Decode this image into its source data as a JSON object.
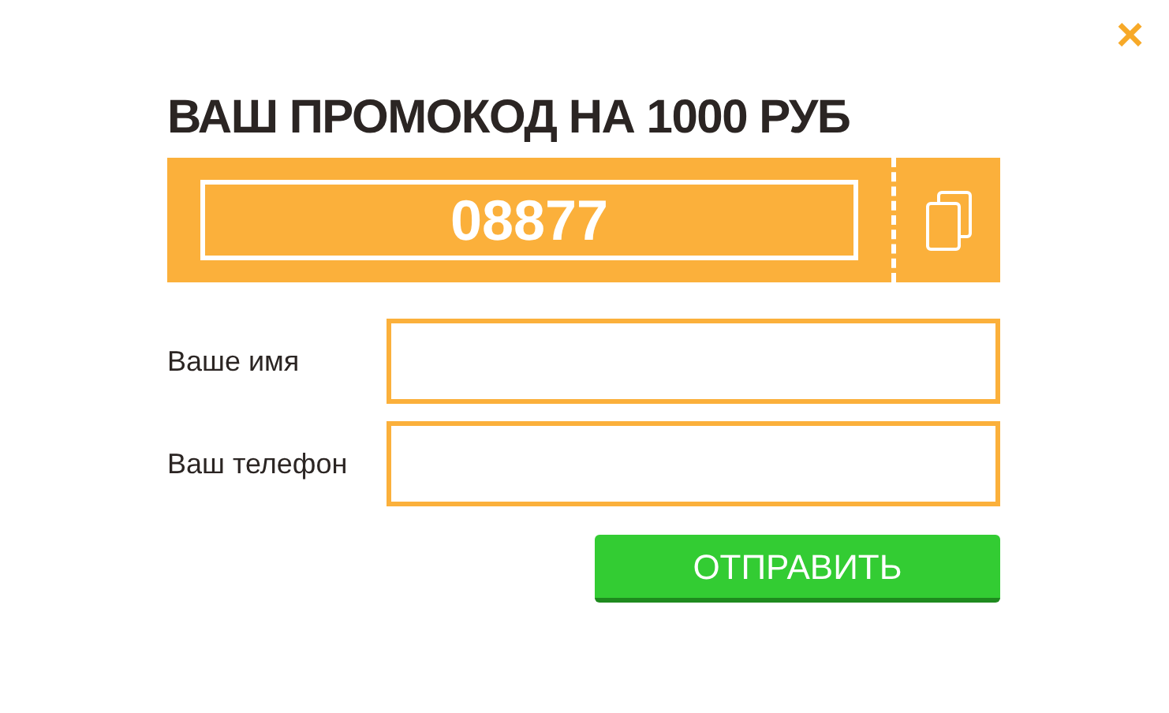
{
  "close": {
    "label": "×"
  },
  "title": "ВАШ ПРОМОКОД НА 1000 РУБ",
  "promo": {
    "code": "08877"
  },
  "fields": [
    {
      "label": "Ваше имя"
    },
    {
      "label": "Ваш телефон"
    }
  ],
  "submit": {
    "label": "ОТПРАВИТЬ"
  }
}
